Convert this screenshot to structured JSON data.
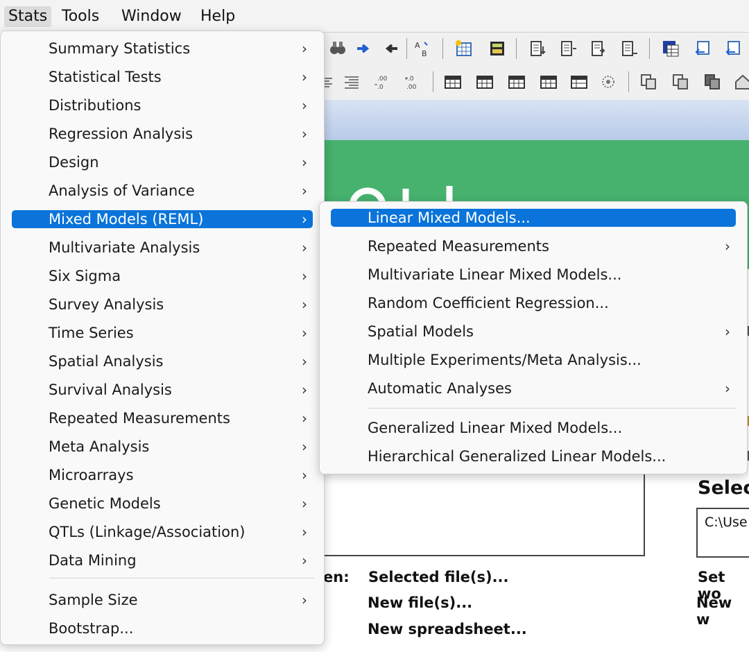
{
  "menubar": {
    "items": [
      "Stats",
      "Tools",
      "Window",
      "Help"
    ]
  },
  "stats_menu": {
    "items": [
      {
        "label": "Summary Statistics",
        "submenu": true
      },
      {
        "label": "Statistical Tests",
        "submenu": true
      },
      {
        "label": "Distributions",
        "submenu": true
      },
      {
        "label": "Regression Analysis",
        "submenu": true
      },
      {
        "label": "Design",
        "submenu": true
      },
      {
        "label": "Analysis of Variance",
        "submenu": true
      },
      {
        "label": "Mixed Models (REML)",
        "submenu": true,
        "highlighted": true
      },
      {
        "label": "Multivariate Analysis",
        "submenu": true
      },
      {
        "label": "Six Sigma",
        "submenu": true
      },
      {
        "label": "Survey Analysis",
        "submenu": true
      },
      {
        "label": "Time Series",
        "submenu": true
      },
      {
        "label": "Spatial Analysis",
        "submenu": true
      },
      {
        "label": "Survival Analysis",
        "submenu": true
      },
      {
        "label": "Repeated Measurements",
        "submenu": true
      },
      {
        "label": "Meta Analysis",
        "submenu": true
      },
      {
        "label": "Microarrays",
        "submenu": true
      },
      {
        "label": "Genetic Models",
        "submenu": true
      },
      {
        "label": "QTLs (Linkage/Association)",
        "submenu": true
      },
      {
        "label": "Data Mining",
        "submenu": true
      },
      {
        "label": "Sample Size",
        "submenu": true
      },
      {
        "label": "Bootstrap...",
        "submenu": false
      }
    ]
  },
  "mixed_models_submenu": {
    "items": [
      {
        "label": "Linear Mixed Models...",
        "submenu": false,
        "highlighted": true
      },
      {
        "label": "Repeated Measurements",
        "submenu": true
      },
      {
        "label": "Multivariate Linear Mixed Models...",
        "submenu": false
      },
      {
        "label": "Random Coefficient Regression...",
        "submenu": false
      },
      {
        "label": "Spatial Models",
        "submenu": true
      },
      {
        "label": "Multiple Experiments/Meta Analysis...",
        "submenu": false
      },
      {
        "label": "Automatic Analyses",
        "submenu": true
      },
      {
        "label": "Generalized Linear Mixed Models...",
        "submenu": false
      },
      {
        "label": "Hierarchical Generalized Linear Models...",
        "submenu": false
      }
    ]
  },
  "submenu_arrow": "›",
  "background": {
    "open_label": "en:",
    "links": [
      "Selected file(s)...",
      "New file(s)...",
      "New spreadsheet..."
    ],
    "select_heading": "Selec",
    "path_value": "C:\\Use",
    "set_label": "Set wo",
    "new_label": "New w"
  },
  "colors": {
    "highlight": "#0a74da",
    "green_panel": "#46b26e",
    "menubar_bg": "#f3f3f3",
    "menu_bg": "#f9f9f9"
  }
}
